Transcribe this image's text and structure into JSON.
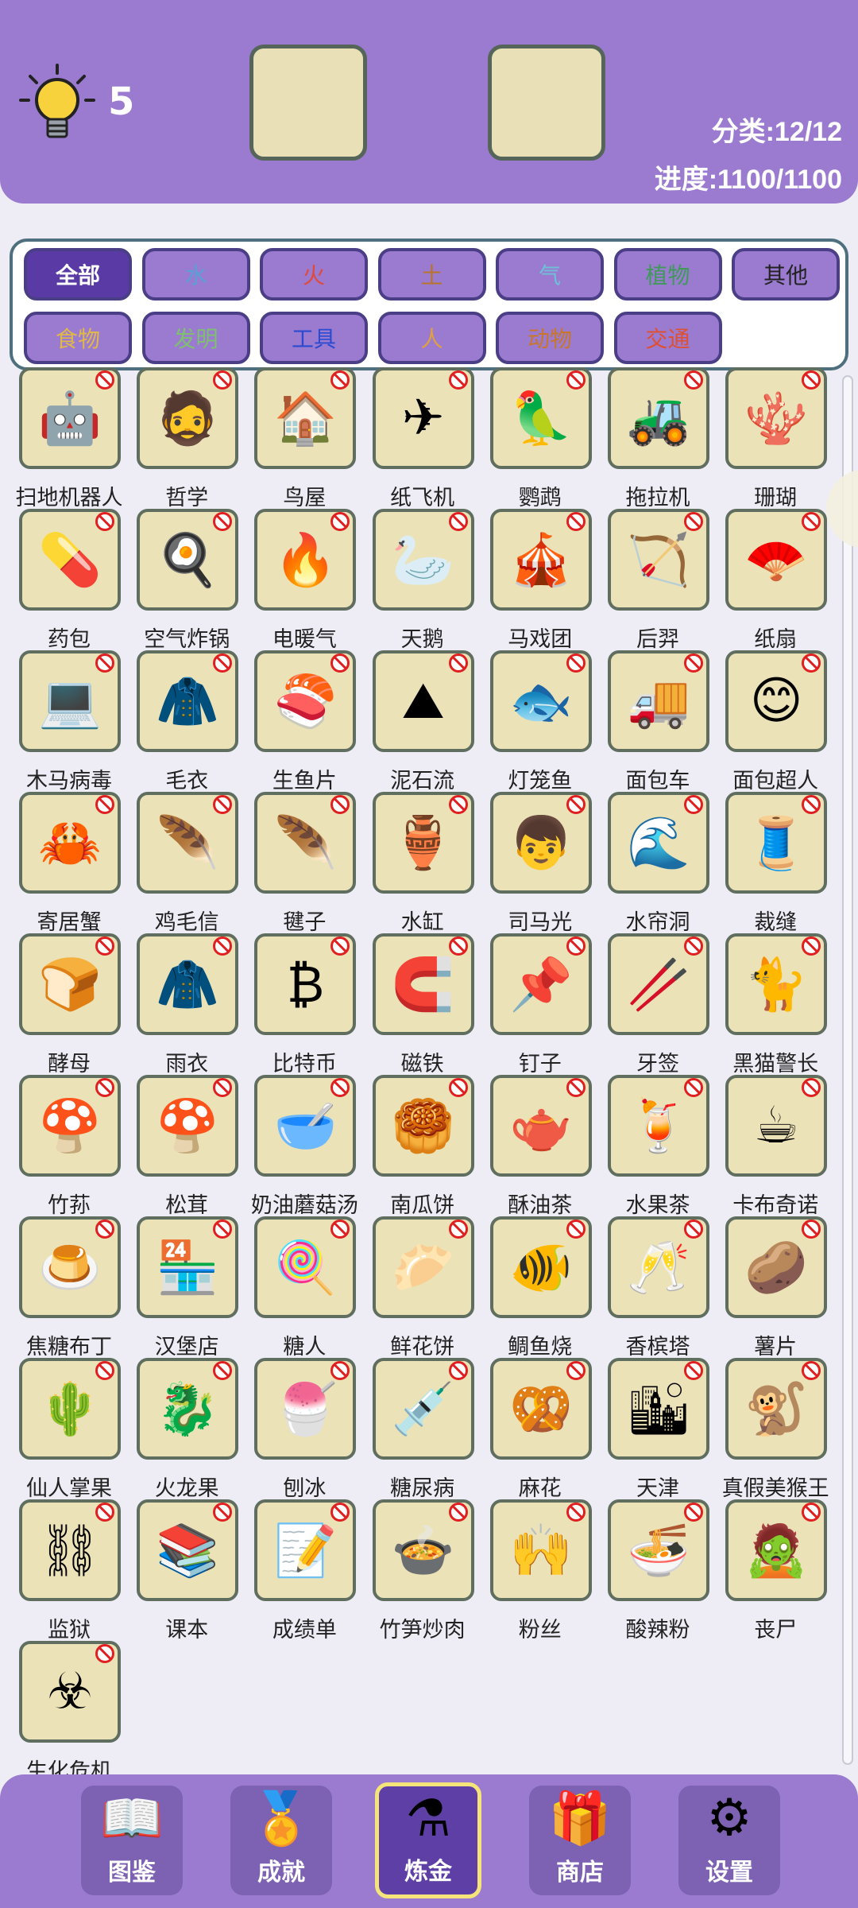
{
  "header": {
    "hint_count": "5",
    "category_stat": "分类:12/12",
    "progress_stat": "进度:1100/1100"
  },
  "filters": [
    {
      "label": "全部",
      "color": "#ffffff",
      "active": true
    },
    {
      "label": "水",
      "color": "#5aa0d8"
    },
    {
      "label": "火",
      "color": "#e04a3a"
    },
    {
      "label": "土",
      "color": "#b8742a"
    },
    {
      "label": "气",
      "color": "#6ec0d8"
    },
    {
      "label": "植物",
      "color": "#3f9a5a"
    },
    {
      "label": "其他",
      "color": "#222222"
    },
    {
      "label": "食物",
      "color": "#e0b84a"
    },
    {
      "label": "发明",
      "color": "#7ec070"
    },
    {
      "label": "工具",
      "color": "#2a4ad0"
    },
    {
      "label": "人",
      "color": "#e0a040"
    },
    {
      "label": "动物",
      "color": "#c8762a"
    },
    {
      "label": "交通",
      "color": "#e05030"
    }
  ],
  "items": [
    {
      "label": "扫地机器人",
      "icon": "🤖"
    },
    {
      "label": "哲学",
      "icon": "🧔"
    },
    {
      "label": "鸟屋",
      "icon": "🏠"
    },
    {
      "label": "纸飞机",
      "icon": "✈"
    },
    {
      "label": "鹦鹉",
      "icon": "🦜"
    },
    {
      "label": "拖拉机",
      "icon": "🚜"
    },
    {
      "label": "珊瑚",
      "icon": "🪸"
    },
    {
      "label": "药包",
      "icon": "💊"
    },
    {
      "label": "空气炸锅",
      "icon": "🍳"
    },
    {
      "label": "电暖气",
      "icon": "🔥"
    },
    {
      "label": "天鹅",
      "icon": "🦢"
    },
    {
      "label": "马戏团",
      "icon": "🎪"
    },
    {
      "label": "后羿",
      "icon": "🏹"
    },
    {
      "label": "纸扇",
      "icon": "🪭"
    },
    {
      "label": "木马病毒",
      "icon": "💻"
    },
    {
      "label": "毛衣",
      "icon": "🧥"
    },
    {
      "label": "生鱼片",
      "icon": "🍣"
    },
    {
      "label": "泥石流",
      "icon": "⛰"
    },
    {
      "label": "灯笼鱼",
      "icon": "🐟"
    },
    {
      "label": "面包车",
      "icon": "🚚"
    },
    {
      "label": "面包超人",
      "icon": "😊"
    },
    {
      "label": "寄居蟹",
      "icon": "🦀"
    },
    {
      "label": "鸡毛信",
      "icon": "🪶"
    },
    {
      "label": "毽子",
      "icon": "🪶"
    },
    {
      "label": "水缸",
      "icon": "🏺"
    },
    {
      "label": "司马光",
      "icon": "👦"
    },
    {
      "label": "水帘洞",
      "icon": "🌊"
    },
    {
      "label": "裁缝",
      "icon": "🧵"
    },
    {
      "label": "酵母",
      "icon": "🍞"
    },
    {
      "label": "雨衣",
      "icon": "🧥"
    },
    {
      "label": "比特币",
      "icon": "₿"
    },
    {
      "label": "磁铁",
      "icon": "🧲"
    },
    {
      "label": "钉子",
      "icon": "📌"
    },
    {
      "label": "牙签",
      "icon": "🥢"
    },
    {
      "label": "黑猫警长",
      "icon": "🐈"
    },
    {
      "label": "竹荪",
      "icon": "🍄"
    },
    {
      "label": "松茸",
      "icon": "🍄"
    },
    {
      "label": "奶油蘑菇汤",
      "icon": "🥣"
    },
    {
      "label": "南瓜饼",
      "icon": "🥮"
    },
    {
      "label": "酥油茶",
      "icon": "🫖"
    },
    {
      "label": "水果茶",
      "icon": "🍹"
    },
    {
      "label": "卡布奇诺",
      "icon": "☕"
    },
    {
      "label": "焦糖布丁",
      "icon": "🍮"
    },
    {
      "label": "汉堡店",
      "icon": "🏪"
    },
    {
      "label": "糖人",
      "icon": "🍭"
    },
    {
      "label": "鲜花饼",
      "icon": "🥟"
    },
    {
      "label": "鲷鱼烧",
      "icon": "🐠"
    },
    {
      "label": "香槟塔",
      "icon": "🥂"
    },
    {
      "label": "薯片",
      "icon": "🥔"
    },
    {
      "label": "仙人掌果",
      "icon": "🌵"
    },
    {
      "label": "火龙果",
      "icon": "🐉"
    },
    {
      "label": "刨冰",
      "icon": "🍧"
    },
    {
      "label": "糖尿病",
      "icon": "💉"
    },
    {
      "label": "麻花",
      "icon": "🥨"
    },
    {
      "label": "天津",
      "icon": "🏙"
    },
    {
      "label": "真假美猴王",
      "icon": "🐒"
    },
    {
      "label": "监狱",
      "icon": "⛓"
    },
    {
      "label": "课本",
      "icon": "📚"
    },
    {
      "label": "成绩单",
      "icon": "📝"
    },
    {
      "label": "竹笋炒肉",
      "icon": "🍲"
    },
    {
      "label": "粉丝",
      "icon": "🙌"
    },
    {
      "label": "酸辣粉",
      "icon": "🍜"
    },
    {
      "label": "丧尸",
      "icon": "🧟"
    },
    {
      "label": "生化危机",
      "icon": "☣"
    }
  ],
  "nav": [
    {
      "label": "图鉴",
      "icon": "📖"
    },
    {
      "label": "成就",
      "icon": "🏅"
    },
    {
      "label": "炼金",
      "icon": "⚗",
      "active": true
    },
    {
      "label": "商店",
      "icon": "🎁"
    },
    {
      "label": "设置",
      "icon": "⚙"
    }
  ]
}
